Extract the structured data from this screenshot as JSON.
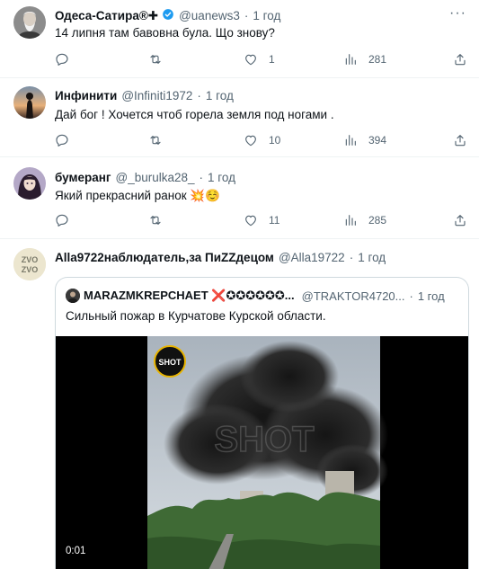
{
  "tweets": [
    {
      "name": "Одеса-Сатира®✚",
      "handle": "@uanews3",
      "time": "1 год",
      "text": "14 липня там бавовна була. Що знову?",
      "replies": "",
      "retweets": "",
      "likes": "1",
      "views": "281",
      "verified": true
    },
    {
      "name": "Инфинити",
      "handle": "@Infiniti1972",
      "time": "1 год",
      "text": "Дай бог ! Хочется чтоб горела земля под ногами .",
      "replies": "",
      "retweets": "",
      "likes": "10",
      "views": "394"
    },
    {
      "name": "бумеранг",
      "handle": "@_burulka28_",
      "time": "1 год",
      "text": "Який прекрасний ранок 💥☺️",
      "replies": "",
      "retweets": "",
      "likes": "11",
      "views": "285"
    },
    {
      "name": "Alla9722наблюдатель,за ПиZZдецом",
      "handle": "@Alla19722",
      "time": "1 год",
      "quote": {
        "name": "MARAZMKREPCHAET ❌✪✪✪✪✪✪...",
        "handle": "@TRAKTOR4720...",
        "time": "1 год",
        "text": "Сильный пожар в Курчатове Курской области.",
        "watermark": "SHOT",
        "duration": "0:01"
      }
    }
  ],
  "icons": {
    "more": "more-icon",
    "reply": "reply-icon",
    "retweet": "retweet-icon",
    "like": "heart-icon",
    "views": "views-icon",
    "share": "share-icon",
    "verified": "verified-badge-icon"
  },
  "colors": {
    "text": "#0f1419",
    "secondary": "#536471",
    "verified": "#1d9bf0",
    "divider": "#eff3f4",
    "explosion": "#e0245e"
  }
}
